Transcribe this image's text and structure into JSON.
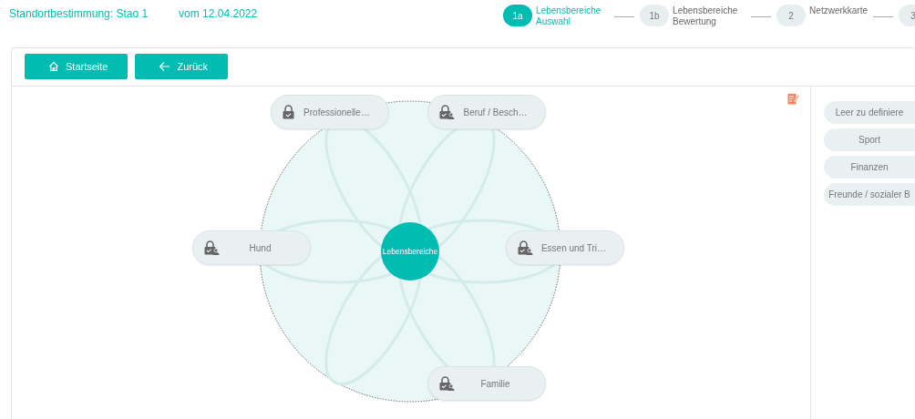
{
  "header": {
    "title": "Standortbestimmung: Stao 1",
    "date": "vom 12.04.2022"
  },
  "steps": [
    {
      "number": "1a",
      "label": "Lebensbereiche Auswahl",
      "selected": true
    },
    {
      "number": "1b",
      "label": "Lebensbereiche Bewertung",
      "selected": false
    },
    {
      "number": "2",
      "label": "Netzwerkkarte",
      "selected": false
    },
    {
      "number": "3",
      "selected": false
    }
  ],
  "toolbar": {
    "buttons": [
      {
        "label": "Startseite",
        "kind": "home"
      },
      {
        "label": "Zurück",
        "kind": "back"
      }
    ]
  },
  "map": {
    "center": "Lebensbereiche",
    "nodes": [
      {
        "label": "Professionelle…",
        "kind": "lock"
      },
      {
        "label": "Beruf / Besch…",
        "kind": "lock-user"
      },
      {
        "label": "Hund",
        "kind": "lock-user"
      },
      {
        "label": "Essen und Tri…",
        "kind": "lock-user"
      },
      {
        "label": "Familie",
        "kind": "lock-user"
      }
    ]
  },
  "sidebar": {
    "items": [
      "Leer zu definiere",
      "Sport",
      "Finanzen",
      "Freunde / sozialer B"
    ]
  }
}
